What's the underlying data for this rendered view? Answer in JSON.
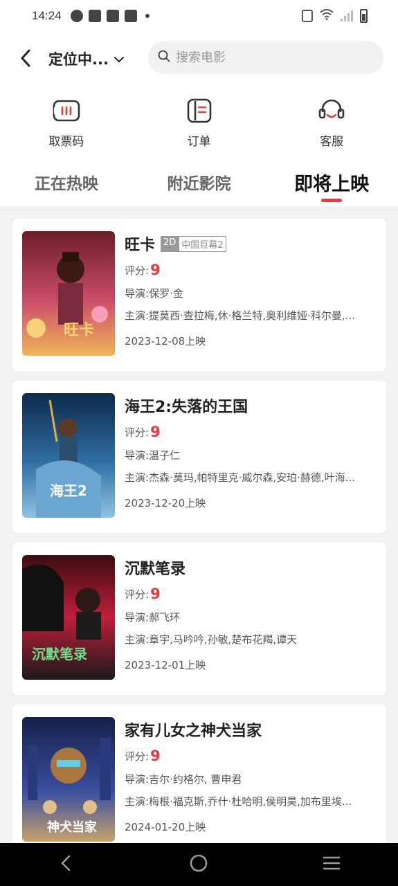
{
  "status_bar": {
    "time": "14:24"
  },
  "header": {
    "location": "定位中...",
    "search_placeholder": "搜索电影"
  },
  "quick_actions": [
    {
      "label": "取票码",
      "icon": "ticket-code-icon"
    },
    {
      "label": "订单",
      "icon": "order-icon"
    },
    {
      "label": "客服",
      "icon": "customer-service-icon"
    }
  ],
  "tabs": [
    {
      "label": "正在热映",
      "active": false
    },
    {
      "label": "附近影院",
      "active": false
    },
    {
      "label": "即将上映",
      "active": true
    }
  ],
  "labels": {
    "score": "评分:",
    "director": "导演:",
    "cast": "主演:"
  },
  "movies": [
    {
      "title": "旺卡",
      "tag_2d": "2D",
      "tag_format": "中国巨幕2",
      "score": "9",
      "director": "保罗·金",
      "cast": "提莫西·查拉梅,休·格兰特,奥利维娅·科尔曼,...",
      "release": "2023-12-08上映",
      "poster_colors": [
        "#6b1d2a",
        "#c94c6a",
        "#f0b35a"
      ]
    },
    {
      "title": "海王2:失落的王国",
      "score": "9",
      "director": "温子仁",
      "cast": "杰森·莫玛,帕特里克·威尔森,安珀·赫德,叶海...",
      "release": "2023-12-20上映",
      "poster_colors": [
        "#0e2a4a",
        "#2f6fa3",
        "#8fc3e0"
      ]
    },
    {
      "title": "沉默笔录",
      "score": "9",
      "director": "郝飞环",
      "cast": "章宇,马吟吟,孙敏,楚布花羯,谭天",
      "release": "2023-12-01上映",
      "poster_colors": [
        "#3b0d12",
        "#c01e3a",
        "#1a1a1a"
      ]
    },
    {
      "title": "家有儿女之神犬当家",
      "score": "9",
      "director": "吉尔·约格尔, 曹申君",
      "cast": "梅根·福克斯,乔什·杜哈明,侯明昊,加布里埃...",
      "release": "2024-01-20上映",
      "poster_colors": [
        "#15204a",
        "#3a4fa0",
        "#c8a36a"
      ]
    }
  ]
}
